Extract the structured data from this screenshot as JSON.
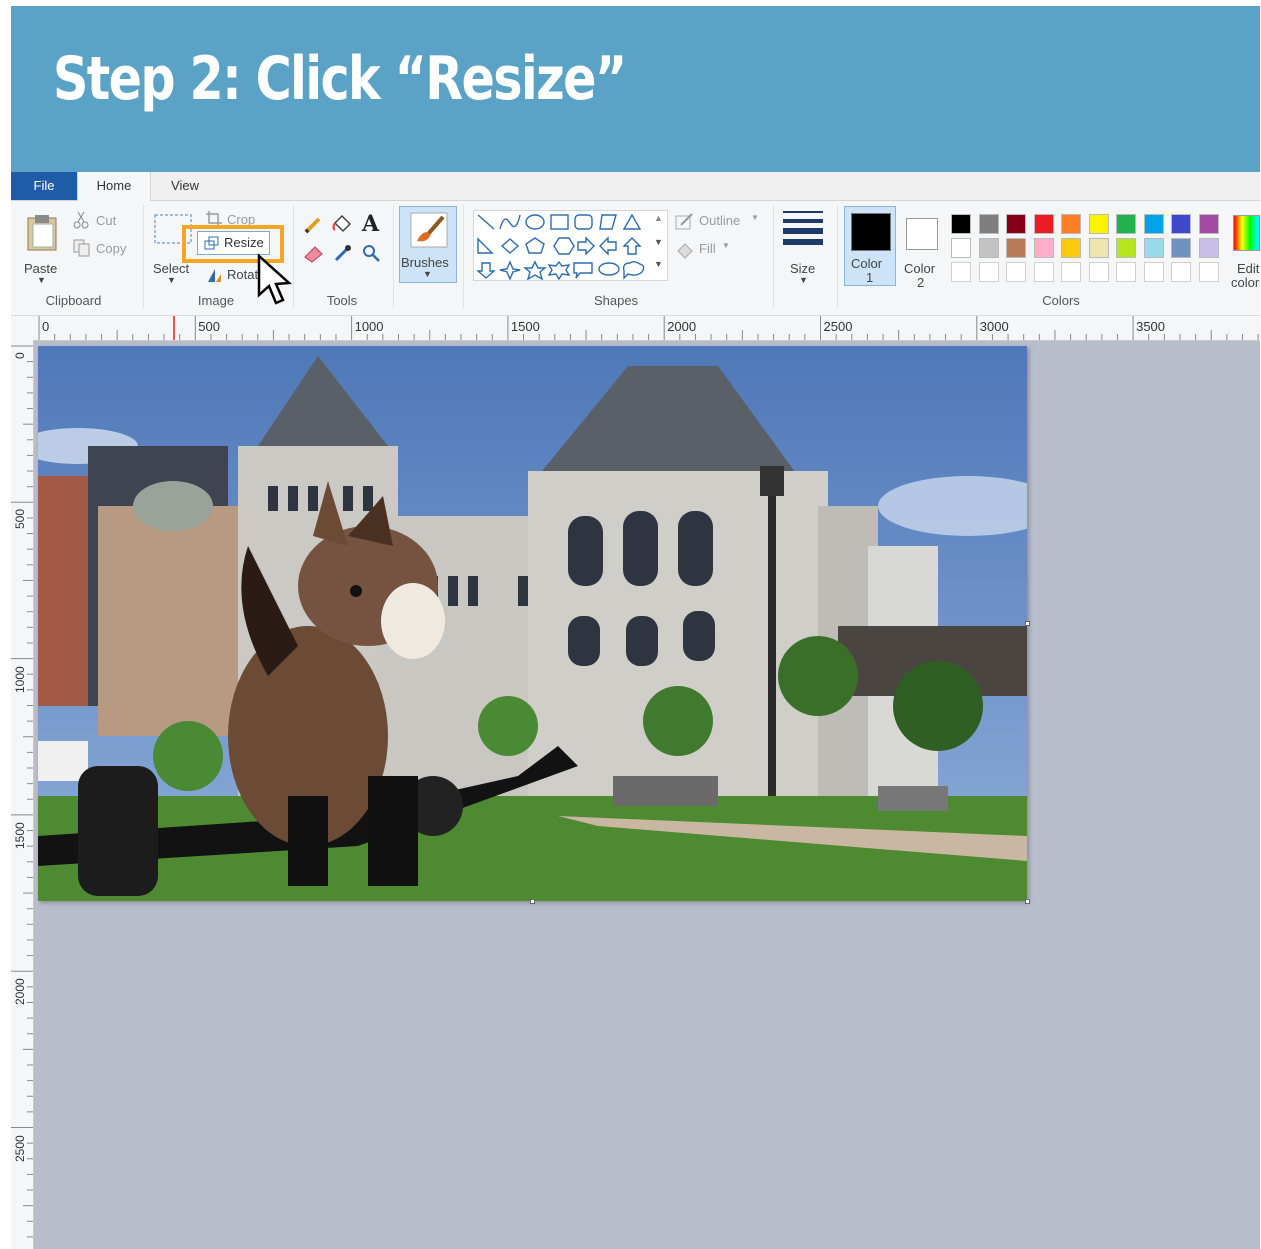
{
  "banner": {
    "title": "Step 2: Click “Resize”",
    "background": "#5aa2c6"
  },
  "tabs": {
    "file": "File",
    "home": "Home",
    "view": "View"
  },
  "clipboard": {
    "paste": "Paste",
    "cut": "Cut",
    "copy": "Copy",
    "group": "Clipboard"
  },
  "image": {
    "select": "Select",
    "crop": "Crop",
    "resize": "Resize",
    "rotate": "Rotate",
    "group": "Image"
  },
  "tools": {
    "group": "Tools"
  },
  "brushes": {
    "label": "Brushes"
  },
  "shapes": {
    "outline": "Outline",
    "fill": "Fill",
    "group": "Shapes"
  },
  "size": {
    "label": "Size"
  },
  "colors": {
    "color1_line1": "Color",
    "color1_line2": "1",
    "color2_line1": "Color",
    "color2_line2": "2",
    "group": "Colors",
    "edit_line1": "Edit",
    "edit_line2": "colors",
    "palette_row1": [
      "#000000",
      "#7f7f7f",
      "#880015",
      "#ed1c24",
      "#ff7f27",
      "#fff200",
      "#22b14c",
      "#00a2e8",
      "#3f48cc",
      "#a349a4"
    ],
    "palette_row2": [
      "#ffffff",
      "#c3c3c3",
      "#b97a57",
      "#ffaec9",
      "#ffc90e",
      "#efe4b0",
      "#b5e61d",
      "#99d9ea",
      "#7092be",
      "#c8bfe7"
    ]
  },
  "ruler_h": [
    "0",
    "500",
    "1000",
    "1500",
    "2000",
    "2500",
    "3000",
    "3500"
  ],
  "ruler_v": [
    "0",
    "500",
    "1000",
    "1500",
    "2000",
    "2500"
  ],
  "accent": "#f5a623"
}
